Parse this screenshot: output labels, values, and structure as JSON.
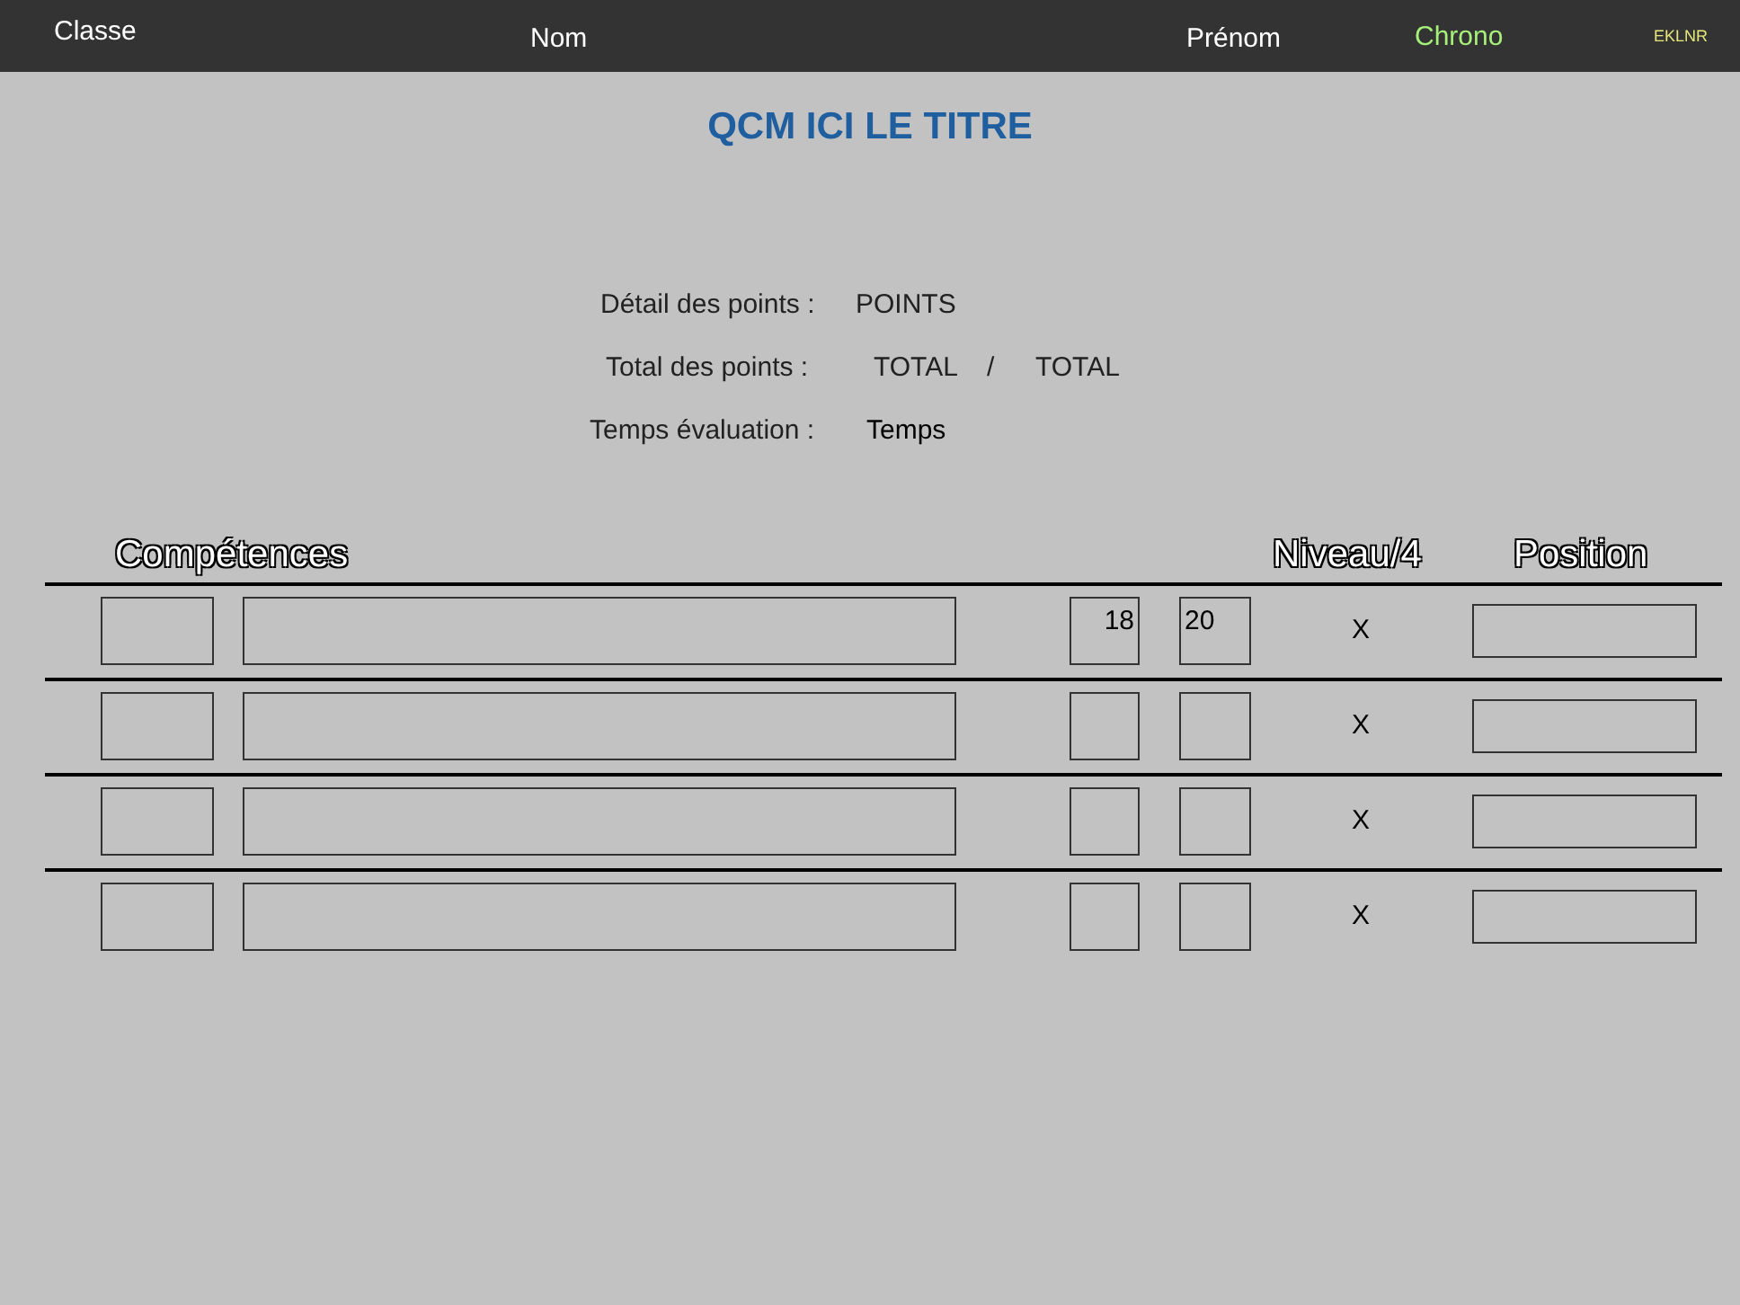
{
  "header": {
    "class_label": "Classe",
    "name_label": "Nom",
    "firstname_label": "Prénom",
    "chrono": "Chrono",
    "code": "EKLNR"
  },
  "title": "QCM ICI LE TITRE",
  "summary": {
    "detail_label": "Détail des points :",
    "detail_value": "POINTS",
    "total_label": "Total des points :",
    "total_value": "TOTAL",
    "separator": "/",
    "total_max": "TOTAL",
    "time_label": "Temps évaluation :",
    "time_value": "Temps"
  },
  "table": {
    "columns": [
      "Compétences",
      "Niveau/4",
      "Position"
    ],
    "rows": [
      {
        "score": "18",
        "max": "20",
        "level": "X"
      },
      {
        "level": "X"
      },
      {
        "level": "X"
      },
      {
        "level": "X"
      }
    ]
  }
}
